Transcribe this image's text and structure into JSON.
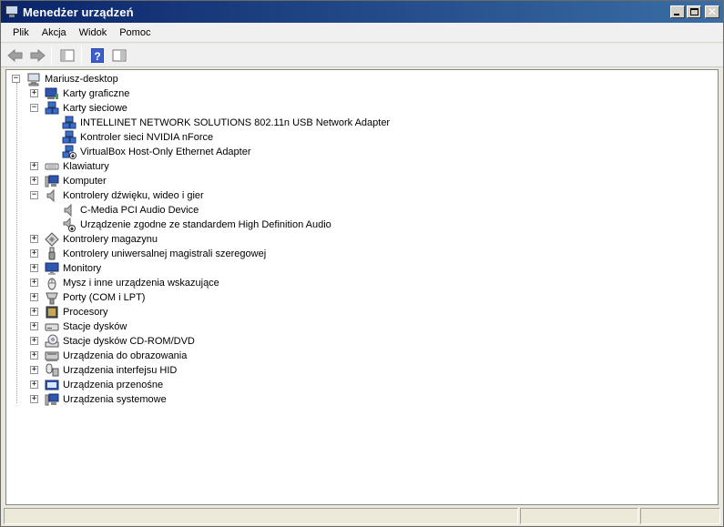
{
  "window": {
    "title": "Menedżer urządzeń"
  },
  "menu": {
    "items": [
      "Plik",
      "Akcja",
      "Widok",
      "Pomoc"
    ]
  },
  "toolbar": {
    "icons": [
      "back-arrow-icon",
      "forward-arrow-icon",
      "show-hide-tree-icon",
      "help-icon",
      "properties-icon"
    ]
  },
  "tree": {
    "root": "Mariusz-desktop",
    "categories": [
      {
        "label": "Karty graficzne",
        "icon": "display-adapter-icon",
        "expanded": false
      },
      {
        "label": "Karty sieciowe",
        "icon": "network-adapter-icon",
        "expanded": true,
        "children": [
          {
            "label": "INTELLINET NETWORK SOLUTIONS 802.11n USB Network Adapter",
            "icon": "network-adapter-icon"
          },
          {
            "label": "Kontroler sieci NVIDIA nForce",
            "icon": "network-adapter-icon"
          },
          {
            "label": "VirtualBox Host-Only Ethernet Adapter",
            "icon": "network-adapter-disabled-icon"
          }
        ]
      },
      {
        "label": "Klawiatury",
        "icon": "keyboard-icon",
        "expanded": false
      },
      {
        "label": "Komputer",
        "icon": "computer-icon",
        "expanded": false
      },
      {
        "label": "Kontrolery dźwięku, wideo i gier",
        "icon": "speaker-icon",
        "expanded": true,
        "children": [
          {
            "label": "C-Media PCI Audio Device",
            "icon": "speaker-icon"
          },
          {
            "label": "Urządzenie zgodne ze standardem High Definition Audio",
            "icon": "speaker-disabled-icon"
          }
        ]
      },
      {
        "label": "Kontrolery magazynu",
        "icon": "storage-controller-icon",
        "expanded": false
      },
      {
        "label": "Kontrolery uniwersalnej magistrali szeregowej",
        "icon": "usb-icon",
        "expanded": false
      },
      {
        "label": "Monitory",
        "icon": "monitor-icon",
        "expanded": false
      },
      {
        "label": "Mysz i inne urządzenia wskazujące",
        "icon": "mouse-icon",
        "expanded": false
      },
      {
        "label": "Porty (COM i LPT)",
        "icon": "port-icon",
        "expanded": false
      },
      {
        "label": "Procesory",
        "icon": "processor-icon",
        "expanded": false
      },
      {
        "label": "Stacje dysków",
        "icon": "disk-drive-icon",
        "expanded": false
      },
      {
        "label": "Stacje dysków CD-ROM/DVD",
        "icon": "cdrom-icon",
        "expanded": false
      },
      {
        "label": "Urządzenia do obrazowania",
        "icon": "imaging-device-icon",
        "expanded": false
      },
      {
        "label": "Urządzenia interfejsu HID",
        "icon": "hid-icon",
        "expanded": false
      },
      {
        "label": "Urządzenia przenośne",
        "icon": "portable-device-icon",
        "expanded": false
      },
      {
        "label": "Urządzenia systemowe",
        "icon": "system-device-icon",
        "expanded": false
      }
    ]
  },
  "colors": {
    "title_gradient_start": "#0a246a",
    "title_gradient_end": "#3a6ea5"
  }
}
